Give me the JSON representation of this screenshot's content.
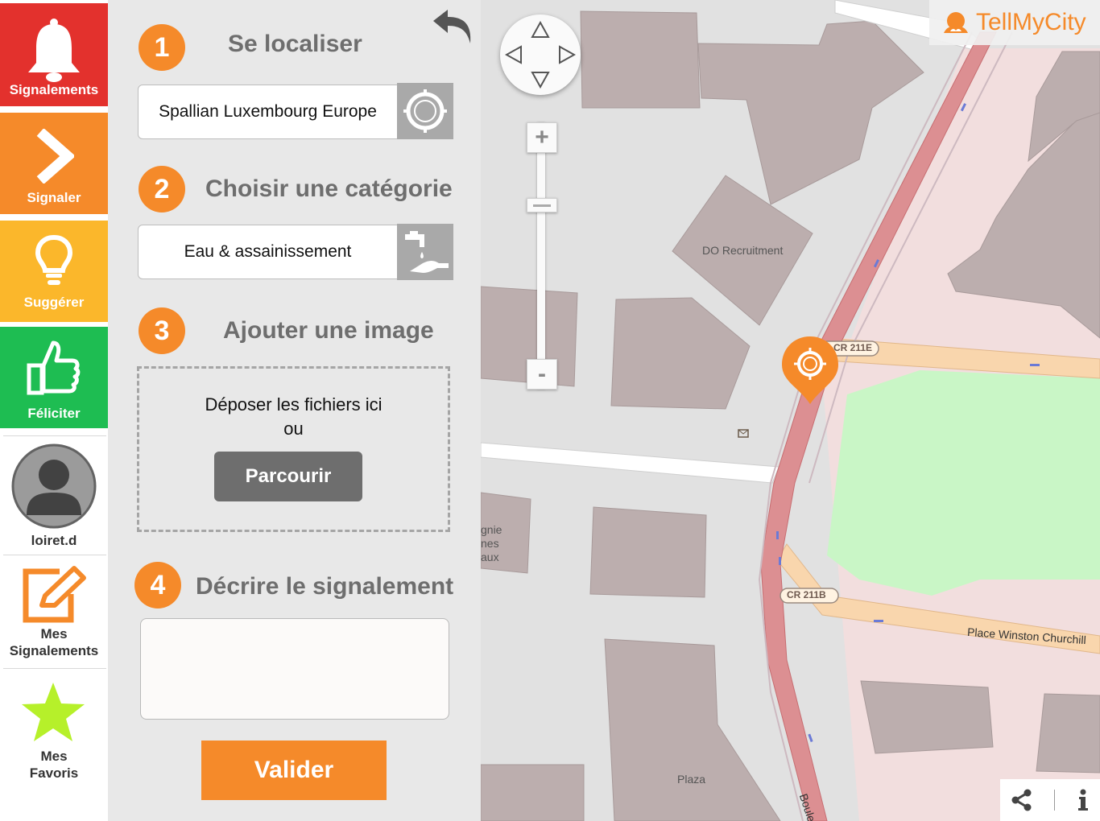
{
  "sidebar": {
    "report_alert_label": "Signalements",
    "signal_label": "Signaler",
    "suggest_label": "Suggérer",
    "congratulate_label": "Féliciter",
    "username": "loiret.d",
    "my_reports_label_line1": "Mes",
    "my_reports_label_line2": "Signalements",
    "my_favorites_label_line1": "Mes",
    "my_favorites_label_line2": "Favoris"
  },
  "form": {
    "step1": {
      "number": "1",
      "title": "Se localiser",
      "value": "Spallian Luxembourg Europe"
    },
    "step2": {
      "number": "2",
      "title": "Choisir une catégorie",
      "value": "Eau & assainissement"
    },
    "step3": {
      "number": "3",
      "title": "Ajouter une image",
      "drop_text": "Déposer les fichiers ici",
      "or_text": "ou",
      "browse_label": "Parcourir"
    },
    "step4": {
      "number": "4",
      "title": "Décrire le signalement",
      "description": ""
    },
    "submit_label": "Valider"
  },
  "map": {
    "brand": "TellMyCity",
    "labels": {
      "poi1": "DO Recruitment",
      "road1": "CR 211E",
      "road2": "CR 211B",
      "place": "Place Winston Churchill",
      "plaza": "Plaza",
      "boulevard": "Boulevard",
      "partial_line1": "gnie",
      "partial_line2": "nes",
      "partial_line3": "aux"
    },
    "zoom_in_label": "+",
    "zoom_out_label": "-"
  },
  "colors": {
    "red": "#e3312d",
    "orange": "#f58a2a",
    "yellow": "#fbb72b",
    "green": "#1ebd52",
    "favorite_star": "#b6f02a"
  }
}
